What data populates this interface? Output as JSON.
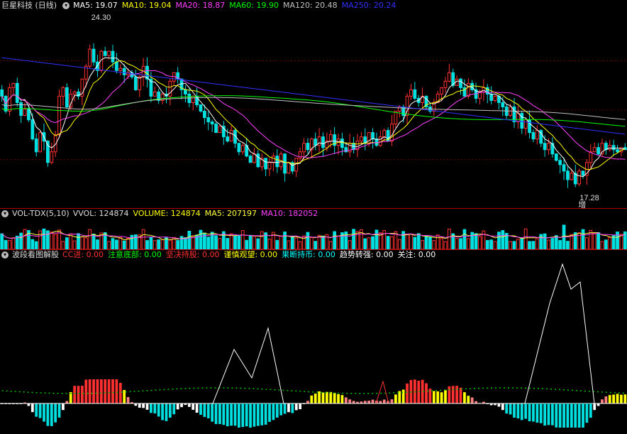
{
  "main": {
    "title": "巨星科技 (日线)",
    "ma": [
      {
        "label": "MA5: 19.07",
        "color": "#ffffff"
      },
      {
        "label": "MA10: 19.04",
        "color": "#ffff00"
      },
      {
        "label": "MA20: 18.87",
        "color": "#ff40ff"
      },
      {
        "label": "MA60: 19.90",
        "color": "#00ff00"
      },
      {
        "label": "MA120: 20.48",
        "color": "#c0c0c0"
      },
      {
        "label": "MA250: 20.24",
        "color": "#3030ff"
      }
    ],
    "high_label": "24.30",
    "low_label": "17.28",
    "zeng_label": "增"
  },
  "vol": {
    "title": "VOL-TDX(5,10)",
    "items": [
      {
        "label": "VVOL: 124874",
        "color": "#dddddd"
      },
      {
        "label": "VOLUME: 124874",
        "color": "#ffff00"
      },
      {
        "label": "MA5: 207197",
        "color": "#ffff40"
      },
      {
        "label": "MA10: 182052",
        "color": "#ff40ff"
      }
    ]
  },
  "ind": {
    "title": "波段看图解股",
    "items": [
      {
        "label": "CC进: 0.00",
        "color": "#ff3030"
      },
      {
        "label": "注意底部: 0.00",
        "color": "#00ff00"
      },
      {
        "label": "坚决持股: 0.00",
        "color": "#ff3030"
      },
      {
        "label": "谨慎观望: 0.00",
        "color": "#ffff00"
      },
      {
        "label": "果断持币: 0.00",
        "color": "#00ffff"
      },
      {
        "label": "趋势转强: 0.00",
        "color": "#ffffff"
      },
      {
        "label": "关注: 0.00",
        "color": "#ffffff"
      }
    ]
  },
  "colors": {
    "up": "#ff3030",
    "down": "#00e0e0",
    "bg": "#000000"
  },
  "chart_data": {
    "type": "candlestick",
    "yrange": [
      16.5,
      25.2
    ],
    "closes": [
      21.5,
      20.8,
      21.9,
      22.1,
      21.2,
      20.6,
      20.9,
      20.4,
      19.5,
      18.9,
      19.8,
      19.4,
      18.4,
      18.9,
      19.7,
      21.5,
      21.9,
      21.0,
      21.6,
      21.7,
      21.5,
      22.3,
      22.9,
      23.7,
      23.1,
      22.7,
      23.6,
      23.4,
      23.6,
      23.1,
      22.7,
      22.8,
      22.5,
      22.6,
      22.4,
      21.8,
      22.4,
      22.9,
      22.3,
      21.5,
      21.7,
      21.3,
      21.6,
      21.5,
      22.2,
      22.6,
      22.3,
      21.8,
      21.6,
      21.2,
      21.5,
      21.1,
      20.8,
      20.5,
      20.3,
      20.2,
      19.8,
      20.1,
      19.6,
      19.4,
      19.9,
      19.3,
      18.9,
      19.2,
      18.7,
      18.4,
      18.8,
      18.2,
      18.6,
      18.1,
      18.4,
      18.7,
      18.2,
      18.8,
      17.9,
      18.4,
      18.0,
      18.6,
      18.9,
      19.3,
      19.0,
      19.5,
      19.2,
      19.6,
      19.1,
      19.4,
      19.7,
      19.2,
      19.5,
      19.1,
      18.9,
      19.3,
      19.0,
      19.4,
      19.6,
      19.3,
      19.8,
      19.5,
      19.2,
      19.6,
      19.9,
      19.4,
      20.2,
      20.8,
      21.0,
      20.6,
      21.5,
      21.8,
      21.4,
      21.2,
      21.5,
      21.0,
      20.8,
      21.2,
      21.6,
      21.9,
      22.2,
      22.6,
      22.0,
      22.3,
      21.9,
      21.5,
      22.1,
      21.8,
      21.4,
      21.7,
      21.9,
      21.6,
      21.3,
      21.5,
      21.2,
      21.0,
      20.6,
      21.0,
      20.3,
      20.7,
      20.0,
      20.4,
      19.8,
      19.5,
      19.9,
      19.3,
      19.0,
      19.3,
      18.8,
      18.5,
      18.3,
      18.0,
      17.6,
      17.9,
      17.4,
      18.0,
      17.8,
      18.4,
      18.9,
      19.1,
      18.8,
      19.3,
      19.0,
      19.2,
      19.0,
      18.9,
      19.1,
      19.0
    ],
    "ma_series": [
      "MA5",
      "MA10",
      "MA20",
      "MA60",
      "MA120",
      "MA250"
    ],
    "volume_type": "bar",
    "indicator_type": "bar+line"
  }
}
